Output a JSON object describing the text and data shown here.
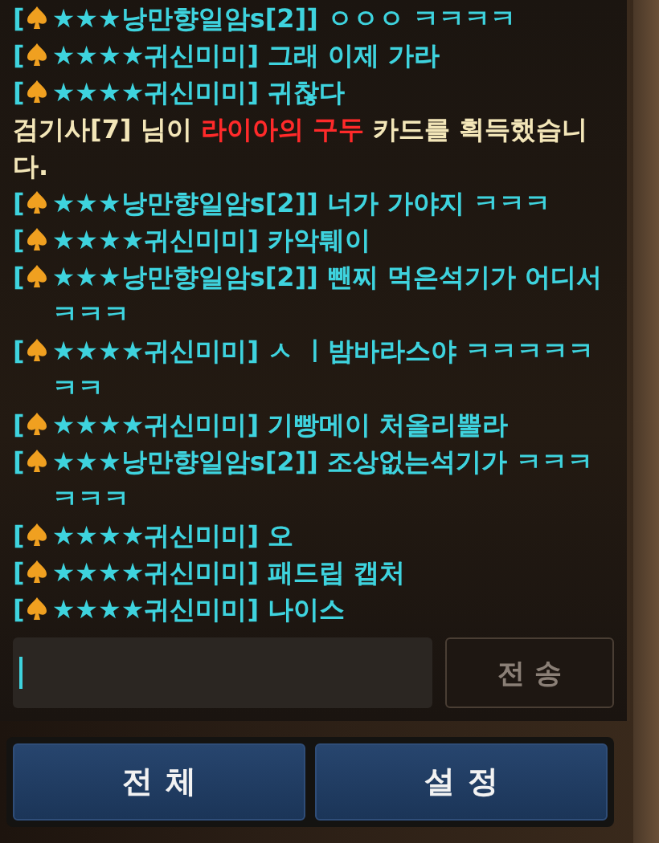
{
  "messages": [
    {
      "kind": "chat",
      "bracket": "[",
      "text": "★★★낭만향일암s[2]] ㅇㅇㅇ ㅋㅋㅋㅋ"
    },
    {
      "kind": "chat",
      "bracket": "[",
      "text": "★★★★귀신미미] 그래 이제 가라"
    },
    {
      "kind": "chat",
      "bracket": "[",
      "text": "★★★★귀신미미] 귀찮다"
    },
    {
      "kind": "system",
      "parts": [
        {
          "text": "검기사[7] 님이 ",
          "highlight": false
        },
        {
          "text": "라이아의 구두",
          "highlight": true
        },
        {
          "text": " 카드를 획득했습니다.",
          "highlight": false
        }
      ]
    },
    {
      "kind": "chat",
      "bracket": "[",
      "text": "★★★낭만향일암s[2]] 너가 가야지 ㅋㅋㅋ"
    },
    {
      "kind": "chat",
      "bracket": "[",
      "text": "★★★★귀신미미] 카악퉤이"
    },
    {
      "kind": "chat",
      "bracket": "[",
      "text": "★★★낭만향일암s[2]] 뺀찌 먹은석기가 어디서 ㅋㅋㅋ"
    },
    {
      "kind": "chat",
      "bracket": "[",
      "text": "★★★★귀신미미] ㅅ ㅣ밤바라스야 ㅋㅋㅋㅋㅋㅋㅋ"
    },
    {
      "kind": "chat",
      "bracket": "[",
      "text": "★★★★귀신미미] 기빵메이 처올리뿔라"
    },
    {
      "kind": "chat",
      "bracket": "[",
      "text": "★★★낭만향일암s[2]] 조상없는석기가 ㅋㅋㅋㅋㅋㅋ"
    },
    {
      "kind": "chat",
      "bracket": "[",
      "text": "★★★★귀신미미] 오"
    },
    {
      "kind": "chat",
      "bracket": "[",
      "text": "★★★★귀신미미] 패드립 캡처"
    },
    {
      "kind": "chat",
      "bracket": "[",
      "text": "★★★★귀신미미] 나이스"
    }
  ],
  "send_button": {
    "label": "전송",
    "disabled": true
  },
  "tabs": [
    {
      "label": "전체"
    },
    {
      "label": "설정"
    }
  ]
}
